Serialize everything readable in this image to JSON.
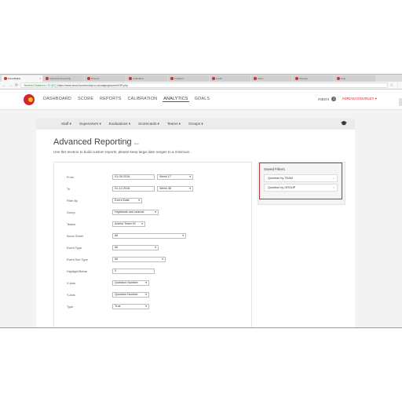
{
  "browser": {
    "tabs": [
      {
        "label": "ScoreBuddy",
        "active": true
      },
      {
        "label": "Advanced Reporting",
        "active": false
      },
      {
        "label": "Reports",
        "active": false
      },
      {
        "label": "Calibration",
        "active": false
      },
      {
        "label": "Analytics",
        "active": false
      },
      {
        "label": "Goals",
        "active": false
      },
      {
        "label": "Inbox",
        "active": false
      },
      {
        "label": "Settings",
        "active": false
      },
      {
        "label": "Help",
        "active": false
      }
    ],
    "url_secure": "Sentient Solutions LTD [IE]",
    "url": "https://www.cloud.scorebuddy.co.uk/staging/scored/OR.php"
  },
  "app": {
    "nav": [
      "DASHBOARD",
      "SCORE",
      "REPORTS",
      "CALIBRATION",
      "ANALYTICS",
      "GOALS"
    ],
    "active_nav": "ANALYTICS",
    "inbox_label": "INBOX",
    "inbox_count": "2",
    "user": "ADRIAN GOURLEY ▾"
  },
  "subnav": [
    "Staff ▾",
    "Supervisors ▾",
    "Evaluations ▾",
    "Scorecards ▾",
    "Teams ▾",
    "Groups ▾"
  ],
  "page": {
    "title": "Advanced Reporting",
    "beta": "beta",
    "intro": "Use this section to build custom reports, please keep large date ranges to a minimum."
  },
  "form": {
    "from_label": "From",
    "from_value": "01-05-2016",
    "from_week": "Week 17",
    "to_label": "To",
    "to_value": "01-12-2016",
    "to_week": "Week 48",
    "filter_by_label": "Filter By",
    "filter_by_value": "Event Date",
    "group_label": "Group",
    "group_value": "Highlands and Islands",
    "teams_label": "Teams",
    "teams_value": "Advice Team HI",
    "score_sheet_label": "Score Sheet",
    "score_sheet_value": "All",
    "event_type_label": "Event Type",
    "event_type_value": "All",
    "event_sub_type_label": "Event Sub Type",
    "event_sub_type_value": "All",
    "highlight_below_label": "Highlight Below",
    "highlight_below_value": "0",
    "x_axis_label": "X-Axis",
    "x_axis_value": "Question Number",
    "y_axis_label": "Y-Axis",
    "y_axis_value": "Question Number",
    "type_label": "Type",
    "type_value": "True"
  },
  "saved_filters": {
    "title": "Saved Filters",
    "items": [
      "Question by TEAM",
      "Question by GROUP"
    ]
  },
  "colors": {
    "brand_red": "#d8232a",
    "highlight_box": "#b5363d"
  }
}
